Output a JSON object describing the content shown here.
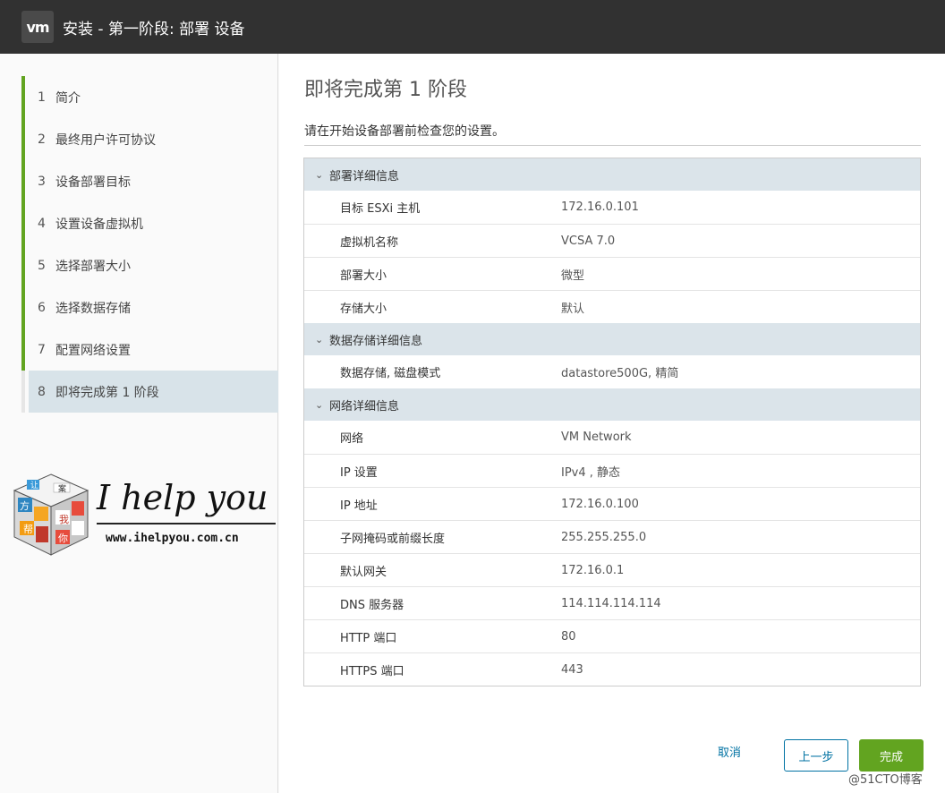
{
  "header": {
    "logo": "vm",
    "title": "安装 - 第一阶段: 部署 设备"
  },
  "sidebar": {
    "steps": [
      {
        "num": "1",
        "label": "简介"
      },
      {
        "num": "2",
        "label": "最终用户许可协议"
      },
      {
        "num": "3",
        "label": "设备部署目标"
      },
      {
        "num": "4",
        "label": "设置设备虚拟机"
      },
      {
        "num": "5",
        "label": "选择部署大小"
      },
      {
        "num": "6",
        "label": "选择数据存储"
      },
      {
        "num": "7",
        "label": "配置网络设置"
      },
      {
        "num": "8",
        "label": "即将完成第 1 阶段"
      }
    ],
    "brand": {
      "text": "I help you",
      "url": "www.ihelpyou.com.cn",
      "cube_chars": [
        "让",
        "方",
        "案",
        "我",
        "帮",
        "你"
      ]
    }
  },
  "main": {
    "title": "即将完成第 1 阶段",
    "subtitle": "请在开始设备部署前检查您的设置。",
    "sections": [
      {
        "title": "部署详细信息",
        "rows": [
          {
            "key": "目标 ESXi 主机",
            "value": "172.16.0.101"
          },
          {
            "key": "虚拟机名称",
            "value": "VCSA 7.0"
          },
          {
            "key": "部署大小",
            "value": "微型"
          },
          {
            "key": "存储大小",
            "value": "默认"
          }
        ]
      },
      {
        "title": "数据存储详细信息",
        "rows": [
          {
            "key": "数据存储, 磁盘模式",
            "value": "datastore500G, 精简"
          }
        ]
      },
      {
        "title": "网络详细信息",
        "rows": [
          {
            "key": "网络",
            "value": "VM Network"
          },
          {
            "key": "IP 设置",
            "value": "IPv4 , 静态"
          },
          {
            "key": "IP 地址",
            "value": "172.16.0.100"
          },
          {
            "key": "子网掩码或前缀长度",
            "value": "255.255.255.0"
          },
          {
            "key": "默认网关",
            "value": "172.16.0.1"
          },
          {
            "key": "DNS 服务器",
            "value": "114.114.114.114"
          },
          {
            "key": "HTTP 端口",
            "value": "80"
          },
          {
            "key": "HTTPS 端口",
            "value": "443"
          }
        ]
      }
    ]
  },
  "footer": {
    "cancel": "取消",
    "back": "上一步",
    "finish": "完成",
    "watermark": "@51CTO博客"
  },
  "colors": {
    "accent": "#62a420",
    "link": "#0072a3",
    "header": "#313131",
    "section": "#dbe4ea"
  }
}
